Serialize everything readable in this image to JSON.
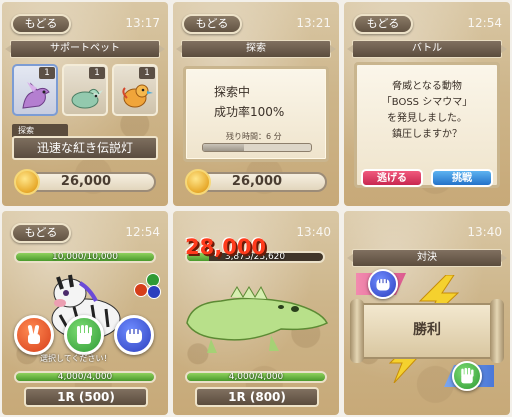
{
  "panels": {
    "p1": {
      "back": "もどる",
      "time": "13:17",
      "title": "サポートペット",
      "pets": [
        {
          "count": "1",
          "color": "#a874c9",
          "selected": true
        },
        {
          "count": "1",
          "color": "#8cc3a8",
          "selected": false
        },
        {
          "count": "1",
          "color": "#e8a43c",
          "selected": false
        }
      ],
      "skill_label": "探索",
      "skill_name": "迅速な紅き伝説灯",
      "money": "26,000"
    },
    "p2": {
      "back": "もどる",
      "time": "13:21",
      "title": "探索",
      "status_line1": "探索中",
      "status_line2": "成功率100%",
      "remaining": "残り時間：6 分",
      "progress": 0.38,
      "money": "26,000"
    },
    "p3": {
      "back": "もどる",
      "time": "12:54",
      "title": "バトル",
      "lines": [
        "脅威となる動物",
        "「BOSS シマウマ」",
        "を発見しました。",
        "鎮圧しますか？"
      ],
      "run_label": "逃げる",
      "fight_label": "挑戦"
    },
    "p4": {
      "back": "もどる",
      "time": "12:54",
      "enemy_hp": "10,000/10,000",
      "enemy_hp_ratio": 1.0,
      "prompt": "選択してください！",
      "player_hp": "4,000/4,000",
      "player_hp_ratio": 1.0,
      "cost": "1R (500)"
    },
    "p5": {
      "time": "13:40",
      "damage": "28,000",
      "enemy_hp": "3,873/23,620",
      "enemy_hp_ratio": 0.164,
      "player_hp": "4,000/4,000",
      "player_hp_ratio": 1.0,
      "cost": "1R (800)"
    },
    "p6": {
      "time": "13:40",
      "title": "対決",
      "result": "勝利"
    }
  },
  "colors": {
    "hp_green": "#5ab534",
    "run_pink": "#e0416a",
    "fight_blue": "#3a8fe0",
    "damage_red": "#ff3b1c"
  },
  "icons": {
    "rock": "rock-hand-icon",
    "paper": "paper-hand-icon",
    "scissors": "scissors-hand-icon",
    "coin": "coin-icon"
  }
}
